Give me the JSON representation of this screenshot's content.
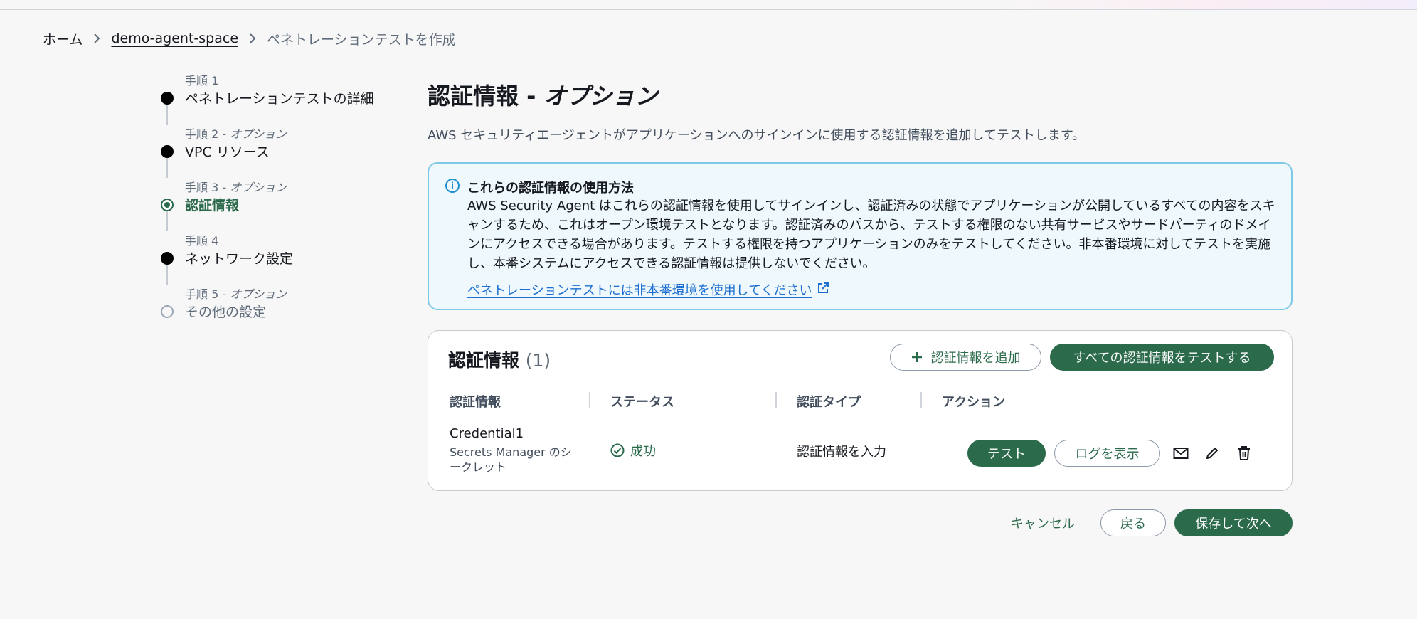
{
  "breadcrumb": {
    "home": "ホーム",
    "space": "demo-agent-space",
    "current": "ペネトレーションテストを作成"
  },
  "steps": [
    {
      "num": "手順 1",
      "optional": "",
      "title": "ペネトレーションテストの詳細",
      "state": "done"
    },
    {
      "num": "手順 2 - ",
      "optional": "オプション",
      "title": "VPC リソース",
      "state": "done"
    },
    {
      "num": "手順 3 - ",
      "optional": "オプション",
      "title": "認証情報",
      "state": "current"
    },
    {
      "num": "手順 4",
      "optional": "",
      "title": "ネットワーク設定",
      "state": "done"
    },
    {
      "num": "手順 5 - ",
      "optional": "オプション",
      "title": "その他の設定",
      "state": "future"
    }
  ],
  "page": {
    "title": "認証情報 - ",
    "title_optional": "オプション",
    "description": "AWS セキュリティエージェントがアプリケーションへのサインインに使用する認証情報を追加してテストします。"
  },
  "info": {
    "heading": "これらの認証情報の使用方法",
    "body": "AWS Security Agent はこれらの認証情報を使用してサインインし、認証済みの状態でアプリケーションが公開しているすべての内容をスキャンするため、これはオープン環境テストとなります。認証済みのパスから、テストする権限のない共有サービスやサードパーティのドメインにアクセスできる場合があります。テストする権限を持つアプリケーションのみをテストしてください。非本番環境に対してテストを実施し、本番システムにアクセスできる認証情報は提供しないでください。",
    "link": "ペネトレーションテストには非本番環境を使用してください"
  },
  "credentials": {
    "title": "認証情報",
    "count": "(1)",
    "add_button": "認証情報を追加",
    "test_all_button": "すべての認証情報をテストする",
    "columns": [
      "認証情報",
      "ステータス",
      "認証タイプ",
      "アクション"
    ],
    "rows": [
      {
        "name": "Credential1",
        "source": "Secrets Manager のシークレット",
        "status": "成功",
        "auth_type": "認証情報を入力",
        "test_button": "テスト",
        "log_button": "ログを表示"
      }
    ]
  },
  "footer": {
    "cancel": "キャンセル",
    "back": "戻る",
    "next": "保存して次へ"
  },
  "colors": {
    "primary": "#2b6a4b",
    "info_border": "#7ec8e8",
    "info_bg": "#eef8fd",
    "link": "#1d6fd1"
  }
}
